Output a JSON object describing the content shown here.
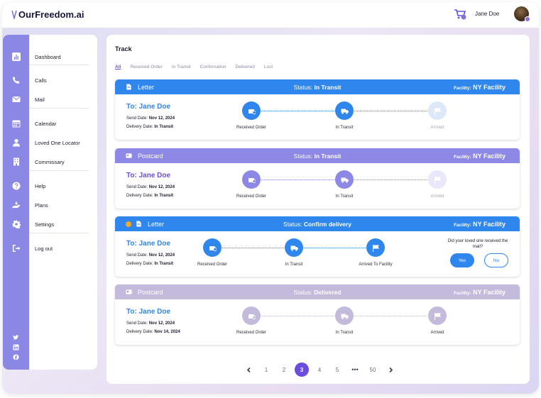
{
  "app": {
    "name": "OurFreedom.ai",
    "user": "Jane Doe"
  },
  "sidebar": {
    "items": [
      {
        "label": "Dashboard",
        "icon": "bar-chart-icon"
      },
      {
        "label": "Calls",
        "icon": "phone-icon"
      },
      {
        "label": "Mail",
        "icon": "mail-icon"
      },
      {
        "label": "Calendar",
        "icon": "calendar-icon"
      },
      {
        "label": "Loved One Locator",
        "icon": "person-icon"
      },
      {
        "label": "Commissary",
        "icon": "building-icon"
      },
      {
        "label": "Help",
        "icon": "help-icon"
      },
      {
        "label": "Plans",
        "icon": "hand-icon"
      },
      {
        "label": "Settings",
        "icon": "gear-icon"
      },
      {
        "label": "Log out",
        "icon": "logout-icon"
      }
    ],
    "social": [
      "twitter-icon",
      "linkedin-icon",
      "facebook-icon"
    ]
  },
  "main": {
    "title": "Track",
    "tabs": [
      "All",
      "Received Order",
      "In Transit",
      "Confirmation",
      "Delivered",
      "Lost"
    ],
    "active_tab": "All"
  },
  "labels": {
    "status": "Status:",
    "facility": "Facility:",
    "send_date": "Send Date:",
    "delivery_date": "Delivery Date:",
    "confirm_question": "Did your loved one received the mail?",
    "yes": "Yes",
    "no": "No"
  },
  "cards": [
    {
      "type": "Letter",
      "status": "In Transit",
      "facility": "NY Facility",
      "to": "To: Jane Doe",
      "send_date": "Nov 12, 2024",
      "delivery_date": "In Transit",
      "steps": [
        "Received Order",
        "In Transit",
        "Arrived"
      ],
      "colors": {
        "header": "#2f86ec",
        "accent": "#2f86ec",
        "pending": "#dde9fb"
      }
    },
    {
      "type": "Postcard",
      "status": "In Transit",
      "facility": "NY Facility",
      "to": "To: Jane Doe",
      "send_date": "Nov 12, 2024",
      "delivery_date": "In Transit",
      "steps": [
        "Received Order",
        "In Transit",
        "Arrived"
      ],
      "colors": {
        "header": "#8d88e6",
        "accent": "#8d88e6",
        "pending": "#e9e7fa"
      }
    },
    {
      "type": "Letter",
      "status": "Confirm delivery",
      "facility": "NY Facility",
      "to": "To: Jane Doe",
      "send_date": "Nov 12, 2024",
      "delivery_date": "In Transit",
      "steps": [
        "Received Order",
        "In Transit",
        "Arrived To Facility"
      ],
      "colors": {
        "header": "#2f86ec",
        "accent": "#2f86ec",
        "pending": "#dde9fb"
      }
    },
    {
      "type": "Postcard",
      "status": "Delivered",
      "facility": "NY Facility",
      "to": "To: Jane Doe",
      "send_date": "Nov 12, 2024",
      "delivery_date": "Nov 14, 2024",
      "steps": [
        "Received Order",
        "In Transit",
        "Arrived"
      ],
      "colors": {
        "header": "#c4bbdc",
        "accent": "#c4bbdc",
        "pending": "#ece8f6"
      }
    }
  ],
  "pagination": {
    "pages": [
      "1",
      "2",
      "3",
      "4",
      "5",
      "•••",
      "50"
    ],
    "current": "3"
  },
  "colors": {
    "brand": "#6c4de0",
    "rail": "#8b87e4"
  }
}
